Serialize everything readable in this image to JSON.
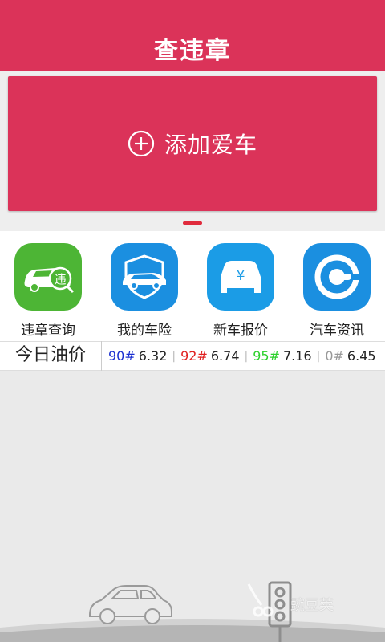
{
  "header": {
    "title": "查违章"
  },
  "banner": {
    "add_label": "添加爱车"
  },
  "grid": [
    {
      "label": "违章查询",
      "icon": "car-violation-icon",
      "color": "#4db535",
      "badge_char": "违"
    },
    {
      "label": "我的车险",
      "icon": "car-shield-icon",
      "color": "#1b8fe0"
    },
    {
      "label": "新车报价",
      "icon": "car-price-icon",
      "color": "#1b9ce6",
      "badge_char": "¥"
    },
    {
      "label": "汽车资讯",
      "icon": "news-e-icon",
      "color": "#1b8fe0"
    }
  ],
  "oil": {
    "title": "今日油价",
    "prices": [
      {
        "grade": "90#",
        "value": "6.32",
        "color": "#1a2fd0"
      },
      {
        "grade": "92#",
        "value": "6.74",
        "color": "#e02020"
      },
      {
        "grade": "95#",
        "value": "7.16",
        "color": "#2bd12b"
      },
      {
        "grade": "0#",
        "value": "6.45",
        "color": "#999999"
      }
    ]
  },
  "watermark": {
    "text": "豌豆荚"
  },
  "colors": {
    "accent": "#db3359",
    "indicator": "#e02b3d"
  }
}
